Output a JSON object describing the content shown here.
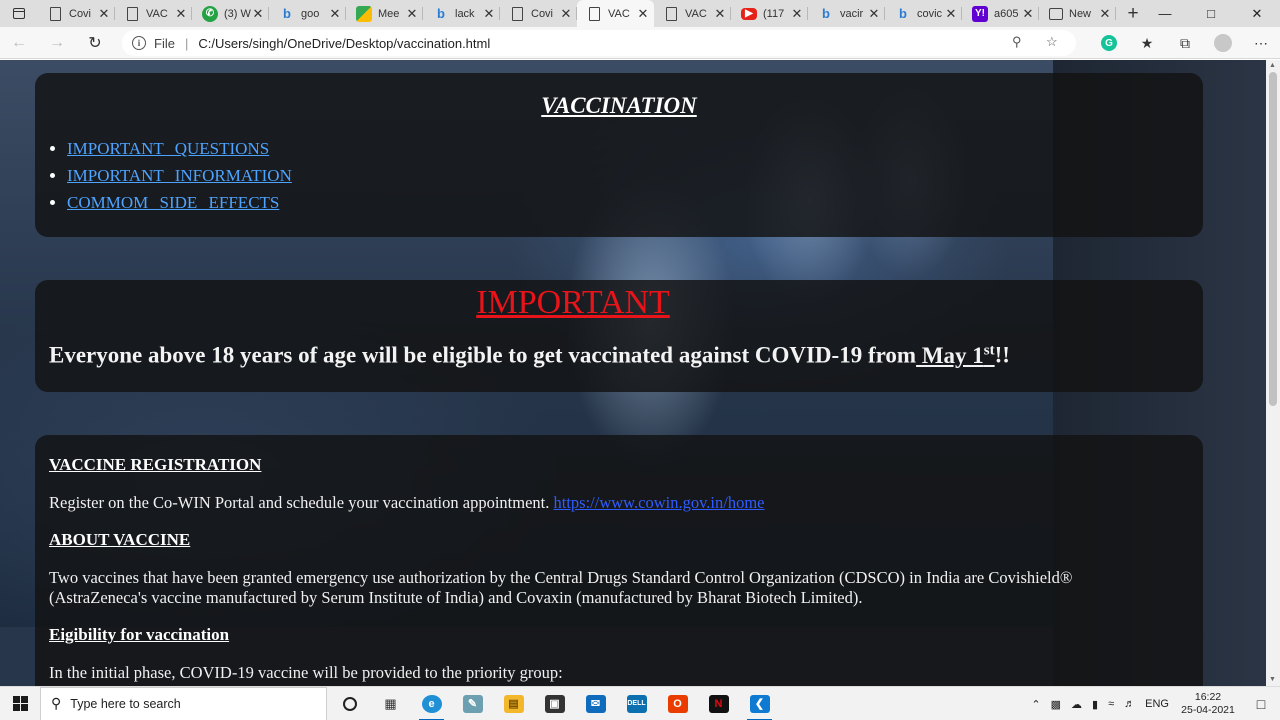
{
  "browser": {
    "tabs": [
      {
        "label": "Covi",
        "icon": "page-icon"
      },
      {
        "label": "VAC",
        "icon": "page-icon"
      },
      {
        "label": "(3) W",
        "icon": "whatsapp-icon"
      },
      {
        "label": "goo",
        "icon": "bing-icon"
      },
      {
        "label": "Mee",
        "icon": "meet-icon"
      },
      {
        "label": "lack",
        "icon": "bing-icon"
      },
      {
        "label": "Covi",
        "icon": "page-icon"
      },
      {
        "label": "VAC",
        "icon": "page-icon",
        "active": true
      },
      {
        "label": "VAC",
        "icon": "page-icon"
      },
      {
        "label": "(117",
        "icon": "youtube-icon"
      },
      {
        "label": "vacir",
        "icon": "bing-icon"
      },
      {
        "label": "covic",
        "icon": "bing-icon"
      },
      {
        "label": "a605",
        "icon": "yahoo-icon"
      },
      {
        "label": "New",
        "icon": "newtab-icon"
      }
    ],
    "address": {
      "scheme": "File",
      "url": "C:/Users/singh/OneDrive/Desktop/vaccination.html"
    }
  },
  "page": {
    "nav": {
      "title": "VACCINATION",
      "links": [
        "IMPORTANT QUESTIONS",
        "IMPORTANT INFORMATION",
        "COMMOM SIDE EFFECTS"
      ]
    },
    "important": {
      "title": "IMPORTANT",
      "text": "Everyone above 18 years of age will be eligible to get vaccinated against COVID-19 from",
      "date": " May 1",
      "date_sup": "st",
      "end": "!!"
    },
    "info": {
      "registration_heading": "VACCINE REGISTRATION",
      "registration_text": "Register on the Co-WIN Portal and schedule your vaccination appointment.",
      "registration_link": "https://www.cowin.gov.in/home",
      "about_heading": "ABOUT VACCINE",
      "about_text": "Two vaccines that have been granted emergency use authorization by the Central Drugs Standard Control Organization (CDSCO) in India are Covishield® (AstraZeneca's vaccine manufactured by Serum Institute of India) and Covaxin (manufactured by Bharat Biotech Limited).",
      "eligibility_heading": "Eigibility for vaccination",
      "eligibility_text": "In the initial phase, COVID-19 vaccine will be provided to the priority group:"
    }
  },
  "taskbar": {
    "search_placeholder": "Type here to search",
    "language": "ENG",
    "time": "16:22",
    "date": "25-04-2021"
  }
}
